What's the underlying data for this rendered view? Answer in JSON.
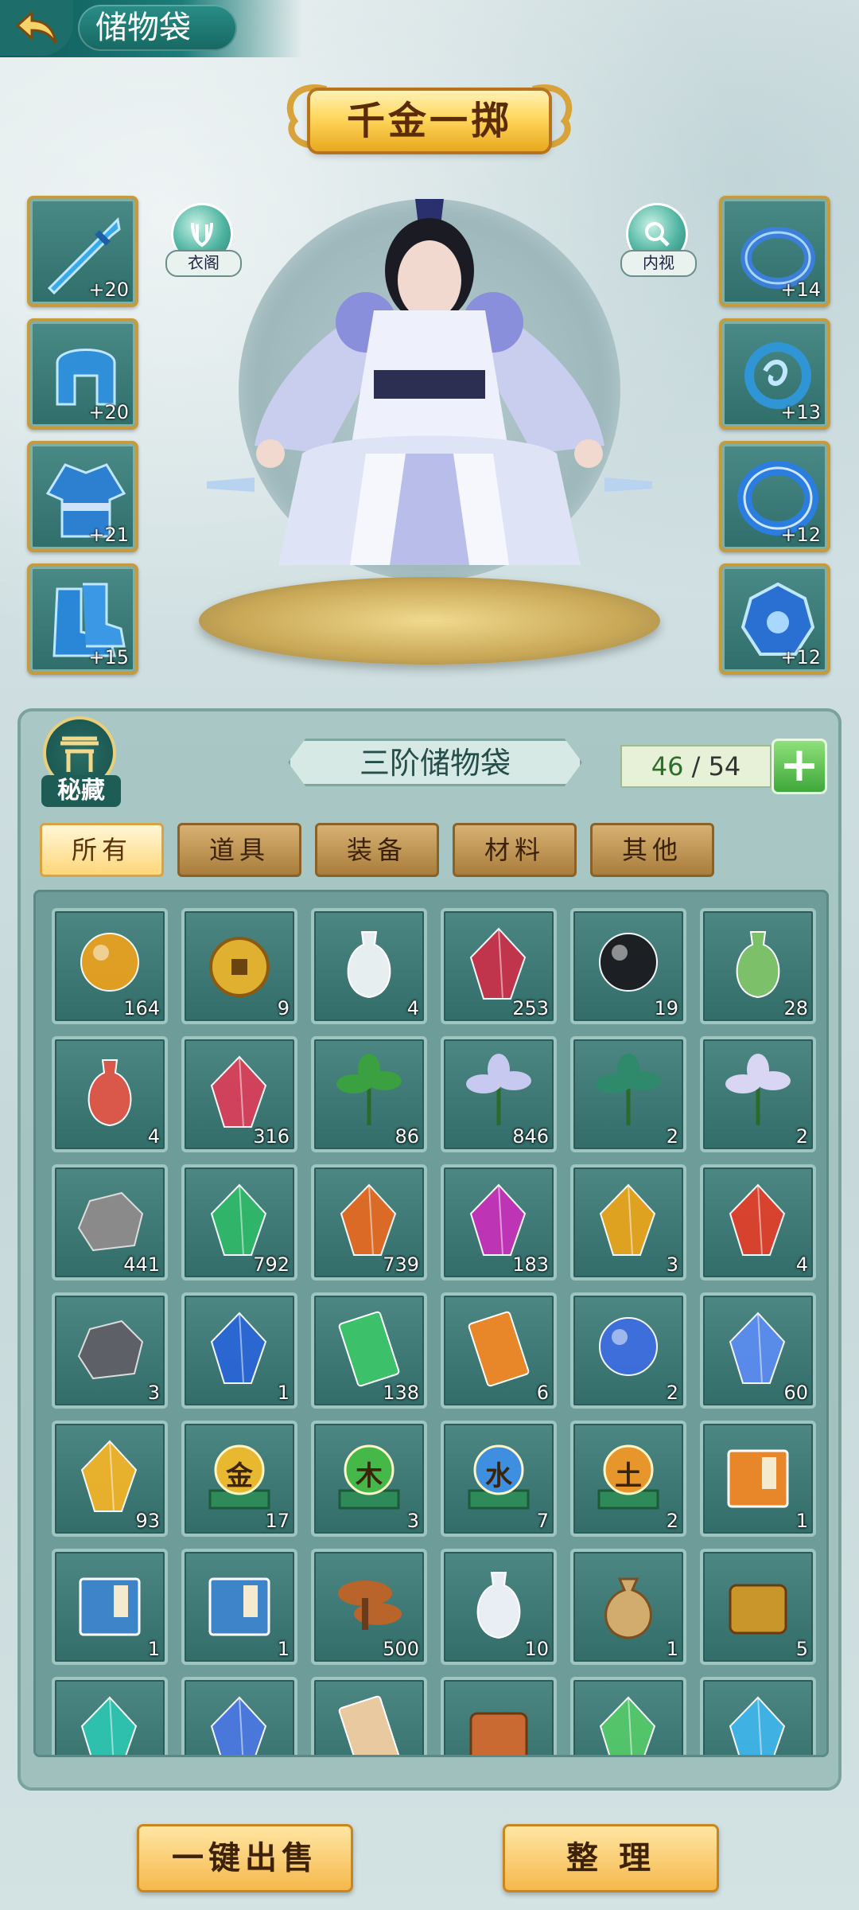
{
  "header": {
    "title": "储物袋",
    "back_icon": "back-arrow-icon"
  },
  "banner": {
    "text": "千金一掷"
  },
  "character_buttons": {
    "wardrobe_label": "衣阁",
    "inner_view_label": "内视"
  },
  "equipment_left": [
    {
      "name": "sword",
      "level": "+20",
      "color": "#3aa9e8"
    },
    {
      "name": "helmet",
      "level": "+20",
      "color": "#2f8fd8"
    },
    {
      "name": "robe",
      "level": "+21",
      "color": "#2d7fd0"
    },
    {
      "name": "boots",
      "level": "+15",
      "color": "#2a86d6"
    }
  ],
  "equipment_right": [
    {
      "name": "ring",
      "level": "+14",
      "color": "#3c7fd8"
    },
    {
      "name": "pendant",
      "level": "+13",
      "color": "#2f95d4"
    },
    {
      "name": "bracelet",
      "level": "+12",
      "color": "#2b7ee0"
    },
    {
      "name": "amulet",
      "level": "+12",
      "color": "#2a6fd2"
    }
  ],
  "bag": {
    "secret_label": "秘藏",
    "title": "三阶储物袋",
    "capacity_used": "46",
    "capacity_sep": "/",
    "capacity_max": "54",
    "add_label": "+"
  },
  "tabs": [
    {
      "label": "所有",
      "active": true
    },
    {
      "label": "道具",
      "active": false
    },
    {
      "label": "装备",
      "active": false
    },
    {
      "label": "材料",
      "active": false
    },
    {
      "label": "其他",
      "active": false
    }
  ],
  "items": [
    {
      "icon": "dragon-orb",
      "count": "164",
      "color": "#e8a020"
    },
    {
      "icon": "gold-coin",
      "count": "9",
      "color": "#e0b030"
    },
    {
      "icon": "white-vase",
      "count": "4",
      "color": "#e6eef0"
    },
    {
      "icon": "red-crystal",
      "count": "253",
      "color": "#c8324a"
    },
    {
      "icon": "black-orb",
      "count": "19",
      "color": "#1b1b1f"
    },
    {
      "icon": "green-gourd",
      "count": "28",
      "color": "#7cc06a"
    },
    {
      "icon": "red-gourd",
      "count": "4",
      "color": "#d9584a"
    },
    {
      "icon": "red-crystal-cluster",
      "count": "316",
      "color": "#d8405a"
    },
    {
      "icon": "herb-leaves",
      "count": "86",
      "color": "#3aa040"
    },
    {
      "icon": "lotus",
      "count": "846",
      "color": "#c8c9f0"
    },
    {
      "icon": "spirit-tree",
      "count": "2",
      "color": "#2e8a6a"
    },
    {
      "icon": "ice-flower",
      "count": "2",
      "color": "#d9d6f4"
    },
    {
      "icon": "grey-rock",
      "count": "441",
      "color": "#8a8a8a"
    },
    {
      "icon": "green-gem",
      "count": "792",
      "color": "#2fb86a"
    },
    {
      "icon": "orange-gem",
      "count": "739",
      "color": "#e36a22"
    },
    {
      "icon": "purple-gem",
      "count": "183",
      "color": "#c432b8"
    },
    {
      "icon": "amber-gem",
      "count": "3",
      "color": "#e8a41c"
    },
    {
      "icon": "red-shard",
      "count": "4",
      "color": "#e0402c"
    },
    {
      "icon": "dark-ore",
      "count": "3",
      "color": "#5d6066"
    },
    {
      "icon": "blue-crystal",
      "count": "1",
      "color": "#2a66d6"
    },
    {
      "icon": "green-talisman",
      "count": "138",
      "color": "#3cc06a"
    },
    {
      "icon": "fire-talisman",
      "count": "6",
      "color": "#e8862a"
    },
    {
      "icon": "blue-spirit-orb",
      "count": "2",
      "color": "#3d6ee0"
    },
    {
      "icon": "rainbow-crystal",
      "count": "60",
      "color": "#5b8cf0"
    },
    {
      "icon": "yellow-crystal",
      "count": "93",
      "color": "#f0b42a"
    },
    {
      "icon": "metal-orb",
      "count": "17",
      "color": "#e8b930",
      "glyph": "金"
    },
    {
      "icon": "wood-orb",
      "count": "3",
      "color": "#46b84a",
      "glyph": "木"
    },
    {
      "icon": "water-orb",
      "count": "7",
      "color": "#3f8fe0",
      "glyph": "水"
    },
    {
      "icon": "earth-orb",
      "count": "2",
      "color": "#e6962a",
      "glyph": "土"
    },
    {
      "icon": "orange-book",
      "count": "1",
      "color": "#e8862a"
    },
    {
      "icon": "blue-book",
      "count": "1",
      "color": "#3d84c8"
    },
    {
      "icon": "blue-book-2",
      "count": "1",
      "color": "#3d84c8"
    },
    {
      "icon": "mushroom",
      "count": "500",
      "color": "#b8642a"
    },
    {
      "icon": "porcelain-vase",
      "count": "10",
      "color": "#e8eef4"
    },
    {
      "icon": "cloth-sack",
      "count": "1",
      "color": "#d2ab6e"
    },
    {
      "icon": "golden-beast",
      "count": "5",
      "color": "#c8962a"
    },
    {
      "icon": "teal-crystal",
      "count": "",
      "color": "#2ec4b0"
    },
    {
      "icon": "blue-shard",
      "count": "",
      "color": "#4a78e0"
    },
    {
      "icon": "scroll",
      "count": "",
      "color": "#e8c9a0"
    },
    {
      "icon": "bronze-box",
      "count": "",
      "color": "#c86a32"
    },
    {
      "icon": "green-crystal",
      "count": "",
      "color": "#54c86a"
    },
    {
      "icon": "sky-crystal",
      "count": "",
      "color": "#3fb4e8"
    }
  ],
  "actions": {
    "sell_label": "一键出售",
    "sort_label": "整 理"
  }
}
